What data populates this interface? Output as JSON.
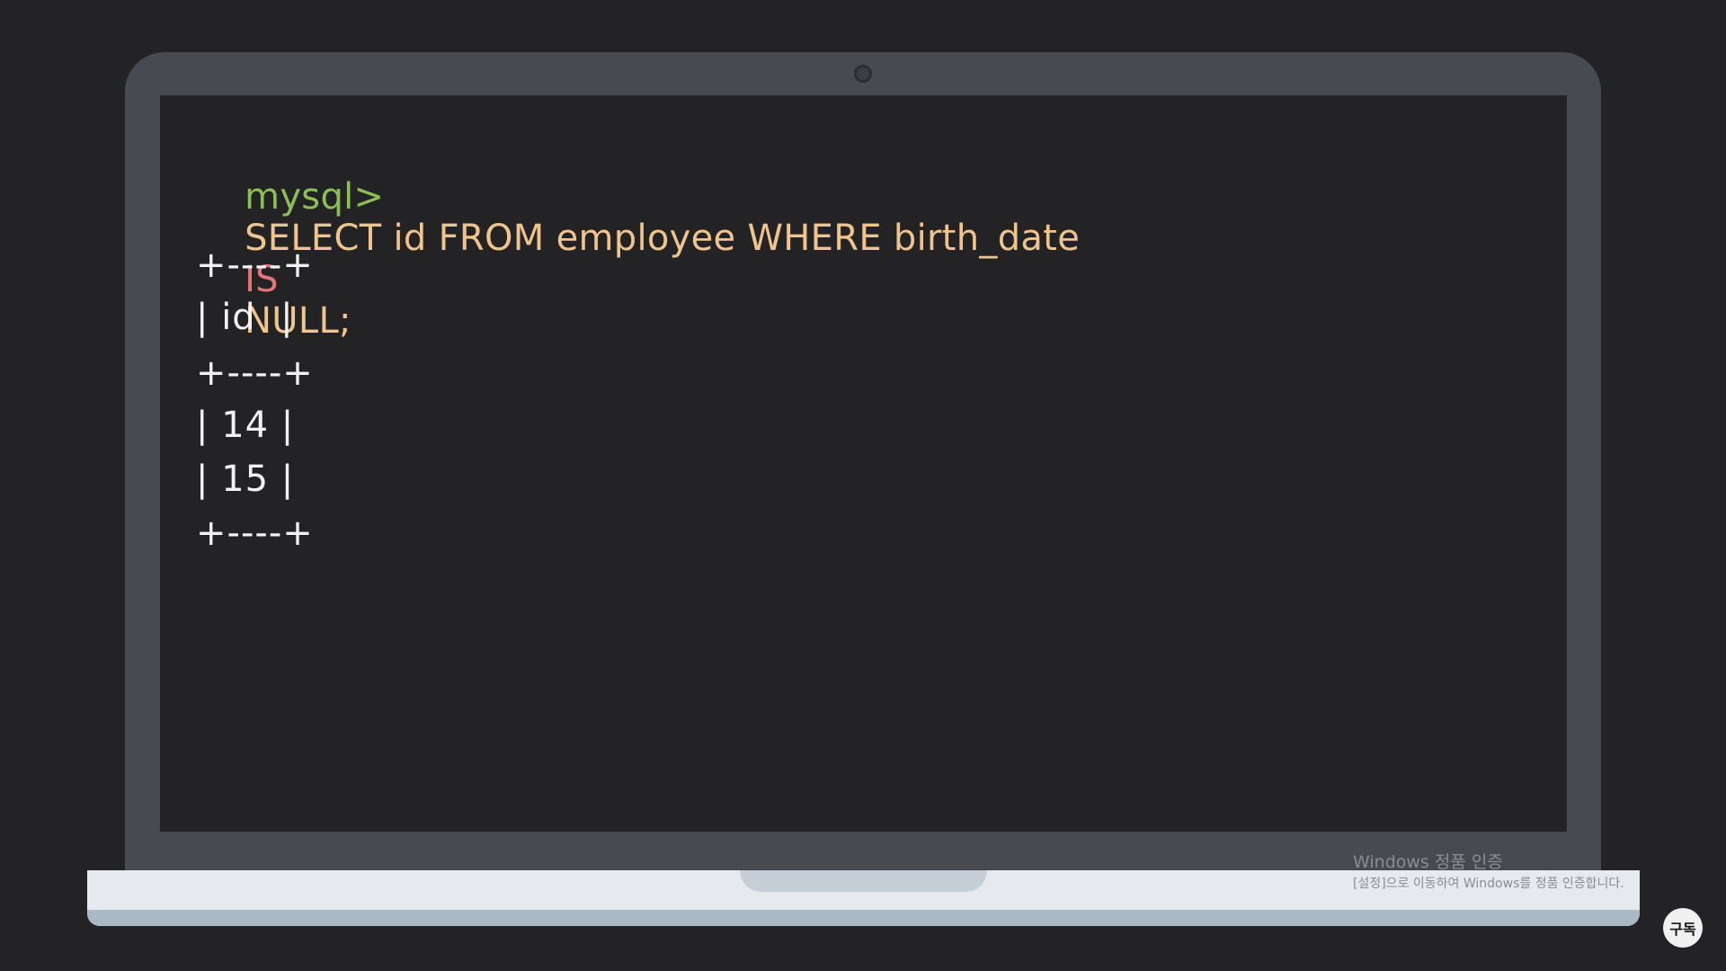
{
  "terminal": {
    "prompt": "mysql>",
    "command_parts": {
      "select": "SELECT id FROM employee WHERE birth_date",
      "is": "IS",
      "tail": "NULL;"
    },
    "result_lines": [
      "+----+",
      "| id  |",
      "+----+",
      "| 14 |",
      "| 15 |",
      "+----+"
    ]
  },
  "watermark": {
    "title": "Windows 정품 인증",
    "subtitle": "[설정]으로 이동하여 Windows를 정품 인증합니다."
  },
  "badge": {
    "label": "구독"
  },
  "colors": {
    "prompt": "#8cbf55",
    "keyword": "#f0c48c",
    "is_keyword": "#e8737b",
    "background": "#232325",
    "bezel": "#474b50"
  }
}
